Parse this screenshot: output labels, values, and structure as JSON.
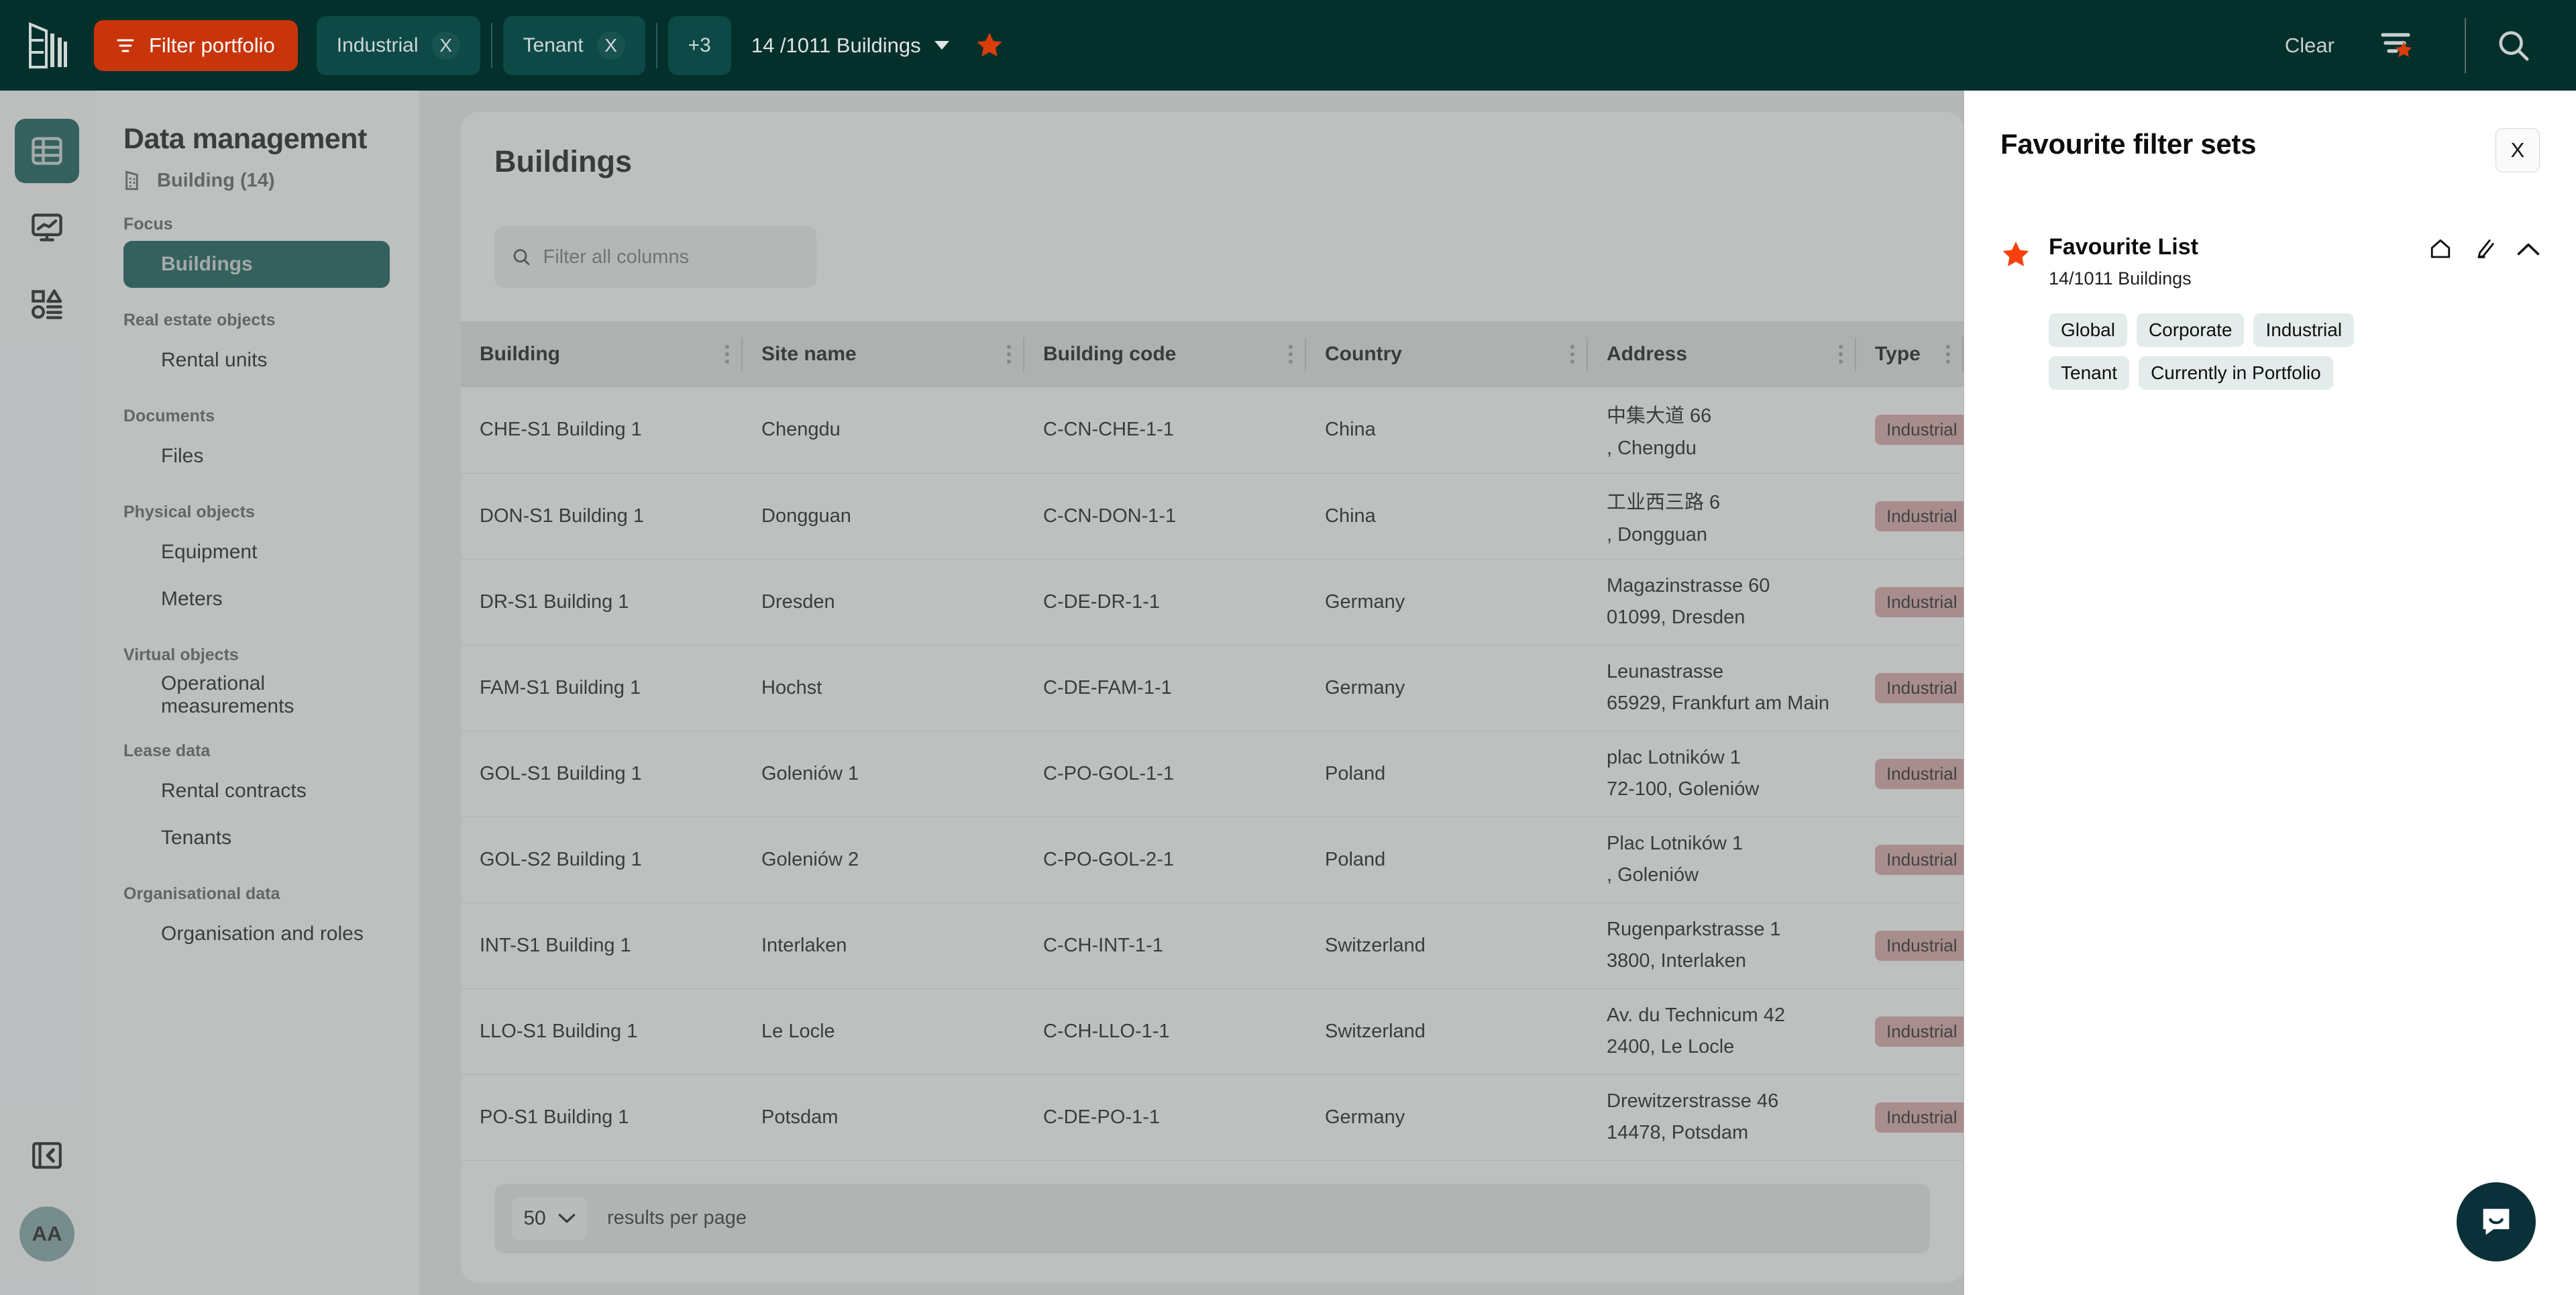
{
  "topbar": {
    "logo_name": "building-logo",
    "filter_portfolio_label": "Filter portfolio",
    "chips": [
      {
        "label": "Industrial",
        "close": "X"
      },
      {
        "label": "Tenant",
        "close": "X"
      }
    ],
    "more_chip_label": "+3",
    "count_label": "14 /1011 Buildings",
    "clear_label": "Clear",
    "accent_orange": "#c8350a",
    "dark_green": "#04302c",
    "chip_green": "#0d4a47"
  },
  "rail": {
    "items": [
      {
        "icon": "table-grid-icon",
        "active": true
      },
      {
        "icon": "monitor-chart-icon",
        "active": false
      },
      {
        "icon": "shapes-list-icon",
        "active": false
      }
    ],
    "collapse_icon": "panel-collapse-icon",
    "avatar_initials": "AA"
  },
  "sidebar": {
    "title": "Data management",
    "subtitle": "Building (14)",
    "subtitle_icon": "building-icon",
    "groups": [
      {
        "label": "Focus",
        "items": [
          {
            "label": "Buildings",
            "active": true
          }
        ]
      },
      {
        "label": "Real estate objects",
        "items": [
          {
            "label": "Rental units",
            "active": false
          }
        ]
      },
      {
        "label": "Documents",
        "items": [
          {
            "label": "Files",
            "active": false
          }
        ]
      },
      {
        "label": "Physical objects",
        "items": [
          {
            "label": "Equipment",
            "active": false
          },
          {
            "label": "Meters",
            "active": false
          }
        ]
      },
      {
        "label": "Virtual objects",
        "items": [
          {
            "label": "Operational measurements",
            "active": false
          }
        ]
      },
      {
        "label": "Lease data",
        "items": [
          {
            "label": "Rental contracts",
            "active": false
          },
          {
            "label": "Tenants",
            "active": false
          }
        ]
      },
      {
        "label": "Organisational data",
        "items": [
          {
            "label": "Organisation and roles",
            "active": false
          }
        ]
      }
    ]
  },
  "main": {
    "page_title": "Buildings",
    "filter_placeholder": "Filter all columns",
    "filter_value": "",
    "columns": [
      "Building",
      "Site name",
      "Building code",
      "Country",
      "Address",
      "Type"
    ],
    "rows": [
      {
        "building": "CHE-S1 Building 1",
        "site": "Chengdu",
        "code": "C-CN-CHE-1-1",
        "country": "China",
        "addr1": "中集大道 66",
        "addr2": ", Chengdu",
        "type": "Industrial"
      },
      {
        "building": "DON-S1 Building 1",
        "site": "Dongguan",
        "code": "C-CN-DON-1-1",
        "country": "China",
        "addr1": "工业西三路 6",
        "addr2": ", Dongguan",
        "type": "Industrial"
      },
      {
        "building": "DR-S1 Building 1",
        "site": "Dresden",
        "code": "C-DE-DR-1-1",
        "country": "Germany",
        "addr1": "Magazinstrasse 60",
        "addr2": "01099, Dresden",
        "type": "Industrial"
      },
      {
        "building": "FAM-S1 Building 1",
        "site": "Hochst",
        "code": "C-DE-FAM-1-1",
        "country": "Germany",
        "addr1": "Leunastrasse",
        "addr2": "65929, Frankfurt am Main",
        "type": "Industrial"
      },
      {
        "building": "GOL-S1 Building 1",
        "site": "Goleniów 1",
        "code": "C-PO-GOL-1-1",
        "country": "Poland",
        "addr1": "plac Lotników 1",
        "addr2": "72-100, Goleniów",
        "type": "Industrial"
      },
      {
        "building": "GOL-S2 Building 1",
        "site": "Goleniów 2",
        "code": "C-PO-GOL-2-1",
        "country": "Poland",
        "addr1": "Plac Lotników 1",
        "addr2": ", Goleniów",
        "type": "Industrial"
      },
      {
        "building": "INT-S1 Building 1",
        "site": "Interlaken",
        "code": "C-CH-INT-1-1",
        "country": "Switzerland",
        "addr1": "Rugenparkstrasse 1",
        "addr2": "3800, Interlaken",
        "type": "Industrial"
      },
      {
        "building": "LLO-S1 Building 1",
        "site": "Le Locle",
        "code": "C-CH-LLO-1-1",
        "country": "Switzerland",
        "addr1": "Av. du Technicum 42",
        "addr2": "2400, Le Locle",
        "type": "Industrial"
      },
      {
        "building": "PO-S1 Building 1",
        "site": "Potsdam",
        "code": "C-DE-PO-1-1",
        "country": "Germany",
        "addr1": "Drewitzerstrasse 46",
        "addr2": "14478, Potsdam",
        "type": "Industrial"
      }
    ],
    "footer": {
      "per_page_value": "50",
      "per_page_label": "results per page"
    },
    "badge_color": "#d8a2a2"
  },
  "panel": {
    "title": "Favourite filter sets",
    "close_label": "X",
    "favourite": {
      "name": "Favourite List",
      "count": "14/1011 Buildings",
      "tags": [
        "Global",
        "Corporate",
        "Industrial",
        "Tenant",
        "Currently in Portfolio"
      ],
      "actions": [
        "home-icon",
        "edit-pencil-icon",
        "chevron-up-icon"
      ]
    }
  },
  "chat": {
    "icon": "chat-bubble-icon"
  }
}
